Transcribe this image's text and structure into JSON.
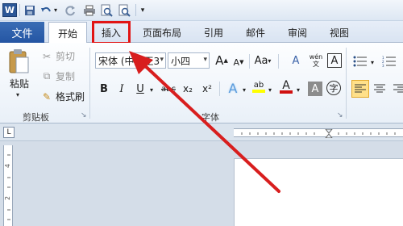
{
  "quick_access": {
    "logo": "W",
    "save_icon": "save-icon",
    "undo_icon": "undo-icon",
    "redo_icon": "redo-icon",
    "print_icon": "print-icon",
    "preview_icon": "print-preview-icon",
    "customize_icon": "customize-icon"
  },
  "tabs": {
    "file": "文件",
    "home": "开始",
    "insert": "插入",
    "page_layout": "页面布局",
    "references": "引用",
    "mailings": "邮件",
    "review": "审阅",
    "view": "视图"
  },
  "clipboard": {
    "paste": "粘贴",
    "cut": "剪切",
    "copy": "复制",
    "format_painter": "格式刷",
    "group_label": "剪贴板"
  },
  "font": {
    "font_name": "宋体 (中文正3",
    "font_size": "小四",
    "grow": "A",
    "shrink": "A",
    "change_case": "Aa",
    "clear_format": "A",
    "phonetic": "wén",
    "char_border": "A",
    "bold": "B",
    "italic": "I",
    "underline": "U",
    "strikethrough": "abc",
    "subscript": "x₂",
    "superscript": "x²",
    "text_effect": "A",
    "highlight": "ab",
    "font_color": "A",
    "char_shading": "A",
    "enclosed_char": "字",
    "group_label": "字体"
  },
  "vertical_ruler_labels": [
    "4",
    "2"
  ],
  "colors": {
    "file_tab": "#2a5ba8",
    "highlight_box": "#e11414",
    "arrow": "#d81e1e",
    "font_color_bar": "#d01010",
    "highlight_bar": "#ffff00"
  }
}
